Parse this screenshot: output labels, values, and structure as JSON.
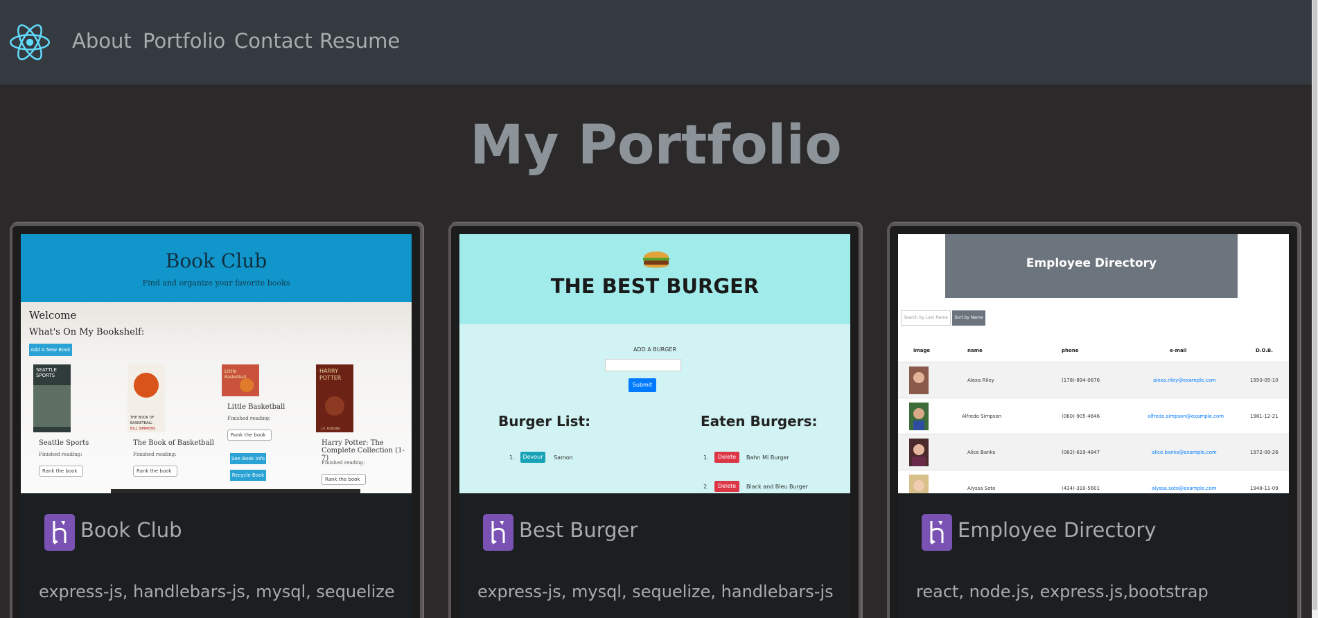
{
  "nav": {
    "links": [
      "About",
      "Portfolio",
      "Contact",
      "Resume"
    ]
  },
  "page": {
    "title": "My Portfolio"
  },
  "projects": [
    {
      "title": "Book Club",
      "tags": "express-js, handlebars-js, mysql, sequelize",
      "screenshot": {
        "header": "Book Club",
        "subheader": "Find and organize your favorite books",
        "welcome": "Welcome",
        "shelf": "What's On My Bookshelf:",
        "add_button": "Add A New Book",
        "books": [
          {
            "title": "Seattle Sports",
            "cover": "SEATTLE SPORTS",
            "finished": "Finished reading:",
            "rank": "Rank the book"
          },
          {
            "title": "The Book of Basketball",
            "cover": "THE BOOK OF BASKETBALL",
            "author": "BILL SIMMONS",
            "finished": "Finished reading:",
            "rank": "Rank the book"
          },
          {
            "title": "Little Basketball",
            "cover": "Little Basketball",
            "finished": "Finished reading:",
            "rank": "Rank the book",
            "buttons": [
              "See Book Info",
              "Recycle Book"
            ]
          },
          {
            "title": "Harry Potter: The Complete Collection (1-7)",
            "cover": "HARRY POTTER",
            "author": "J.K. ROWLING",
            "finished": "Finished reading:",
            "rank": "Rank the book"
          }
        ]
      }
    },
    {
      "title": "Best Burger",
      "tags": "express-js, mysql, sequelize, handlebars-js",
      "screenshot": {
        "header": "THE BEST BURGER",
        "add_label": "ADD A BURGER",
        "submit": "Submit",
        "list_heading": "Burger List:",
        "eaten_heading": "Eaten Burgers:",
        "burgers": [
          {
            "num": "1.",
            "action": "Devour",
            "name": "Samon"
          }
        ],
        "eaten": [
          {
            "num": "1.",
            "action": "Delete",
            "name": "Bahn Mi Burger"
          },
          {
            "num": "2.",
            "action": "Delete",
            "name": "Black and Bleu Burger"
          }
        ]
      }
    },
    {
      "title": "Employee Directory",
      "tags": "react, node.js, express.js,bootstrap",
      "screenshot": {
        "header": "Employee Directory",
        "search_placeholder": "Search by Last Name",
        "sort_button": "Sort by Name",
        "columns": [
          "image",
          "name",
          "phone",
          "e-mail",
          "D.O.B."
        ],
        "rows": [
          {
            "name": "Alexa Riley",
            "phone": "(178)-894-0676",
            "email": "alexa.riley@example.com",
            "dob": "1950-05-10"
          },
          {
            "name": "Alfredo Simpson",
            "phone": "(060)-905-4646",
            "email": "alfredo.simpson@example.com",
            "dob": "1981-12-21"
          },
          {
            "name": "Alice Banks",
            "phone": "(082)-619-4847",
            "email": "alice.banks@example.com",
            "dob": "1972-09-26"
          },
          {
            "name": "Alyssa Soto",
            "phone": "(434)-310-5601",
            "email": "alyssa.soto@example.com",
            "dob": "1948-11-09"
          }
        ]
      }
    }
  ],
  "colors": {
    "navbar": "#343a40",
    "background": "#2b2929",
    "text_muted": "#a9acaf",
    "heroku": "#7952b3",
    "react_logo": "#61dafb"
  },
  "icons": {
    "logo": "react-icon",
    "project_link": "heroku-icon"
  }
}
